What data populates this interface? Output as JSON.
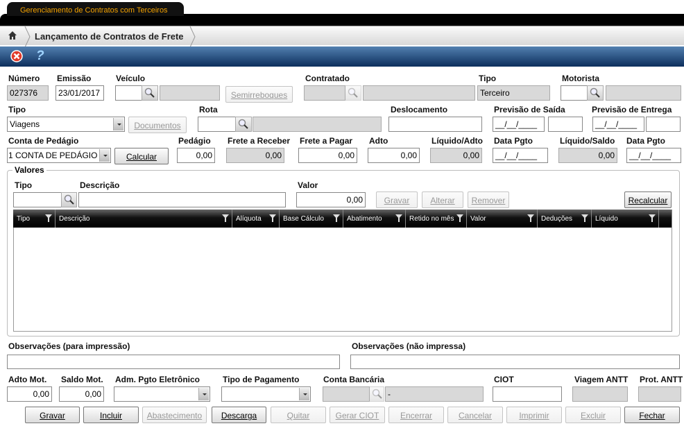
{
  "app_tab": "Gerenciamento de Contratos com Terceiros",
  "breadcrumb": {
    "title": "Lançamento de Contratos de Frete"
  },
  "toolbar": {
    "close_icon": "red-x-circle",
    "help_icon": "question-mark"
  },
  "header": {
    "numero_label": "Número",
    "numero": "027376",
    "emissao_label": "Emissão",
    "emissao": "23/01/2017",
    "veiculo_label": "Veículo",
    "veiculo": "",
    "veiculo_desc": "",
    "semirreboques": "Semirreboques",
    "contratado_label": "Contratado",
    "contratado": "",
    "contratado_desc": "",
    "tipo_label": "Tipo",
    "tipo": "Terceiro",
    "motorista_label": "Motorista",
    "motorista": "",
    "motorista_desc": "",
    "tipo2_label": "Tipo",
    "tipo2": "Viagens",
    "documentos": "Documentos",
    "rota_label": "Rota",
    "rota": "",
    "rota_desc": "",
    "deslocamento_label": "Deslocamento",
    "deslocamento": "",
    "prev_saida_label": "Previsão de Saída",
    "prev_saida_data": "__/__/____",
    "prev_saida_hora": "",
    "prev_entrega_label": "Previsão de Entrega",
    "prev_entrega_data": "__/__/____",
    "prev_entrega_hora": "",
    "conta_pedagio_label": "Conta de Pedágio",
    "conta_pedagio": "1 CONTA DE PEDÁGIO",
    "calcular": "Calcular",
    "pedagio_label": "Pedágio",
    "pedagio": "0,00",
    "frete_receber_label": "Frete a Receber",
    "frete_receber": "0,00",
    "frete_pagar_label": "Frete a Pagar",
    "frete_pagar": "0,00",
    "adto_label": "Adto",
    "adto": "0,00",
    "liquido_adto_label": "Líquido/Adto",
    "liquido_adto": "0,00",
    "data_pgto1_label": "Data Pgto",
    "data_pgto1": "__/__/____",
    "liquido_saldo_label": "Líquido/Saldo",
    "liquido_saldo": "0,00",
    "data_pgto2_label": "Data Pgto",
    "data_pgto2": "__/__/____"
  },
  "valores": {
    "legend": "Valores",
    "tipo_label": "Tipo",
    "tipo": "",
    "descricao_label": "Descrição",
    "descricao": "",
    "valor_label": "Valor",
    "valor": "0,00",
    "buttons": {
      "gravar": "Gravar",
      "alterar": "Alterar",
      "remover": "Remover",
      "recalcular": "Recalcular"
    },
    "columns": [
      "Tipo",
      "Descrição",
      "Alíquota",
      "Base Cálculo",
      "Abatimento",
      "Retido no mês",
      "Valor",
      "Deduções",
      "Líquido"
    ],
    "rows": []
  },
  "footer": {
    "obs_impressao_label": "Observações (para impressão)",
    "obs_impressao": "",
    "obs_nao_impressa_label": "Observações (não impressa)",
    "obs_nao_impressa": "",
    "adto_mot_label": "Adto Mot.",
    "adto_mot": "0,00",
    "saldo_mot_label": "Saldo Mot.",
    "saldo_mot": "0,00",
    "adm_pgto_label": "Adm. Pgto Eletrônico",
    "adm_pgto": "",
    "tipo_pagamento_label": "Tipo de Pagamento",
    "tipo_pagamento": "",
    "conta_bancaria_label": "Conta Bancária",
    "conta_bancaria": "",
    "conta_bancaria_desc": "-",
    "ciot_label": "CIOT",
    "ciot": "",
    "viagem_antt_label": "Viagem ANTT",
    "viagem_antt": "",
    "prot_antt_label": "Prot. ANTT",
    "prot_antt": ""
  },
  "actions": [
    "Gravar",
    "Incluir",
    "Abastecimento",
    "Descarga",
    "Quitar",
    "Gerar CIOT",
    "Encerrar",
    "Cancelar",
    "Imprimir",
    "Excluir",
    "Fechar"
  ]
}
